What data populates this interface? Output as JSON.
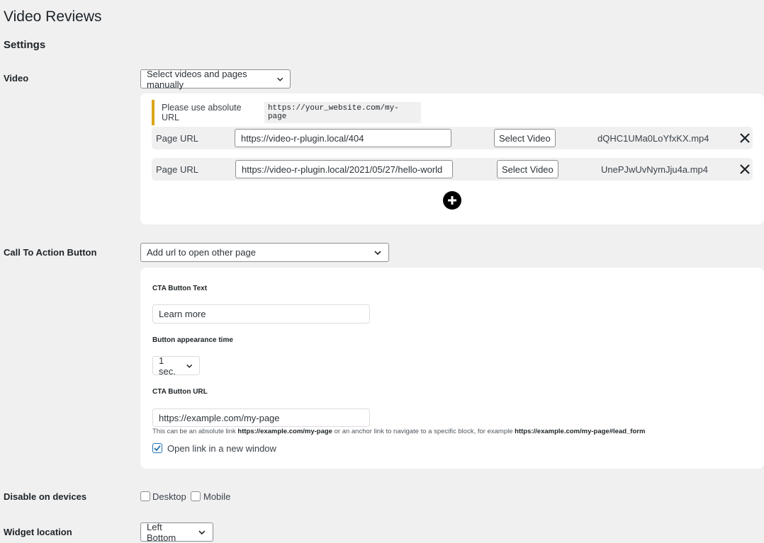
{
  "page_title": "Video Reviews",
  "section_title": "Settings",
  "video": {
    "label": "Video",
    "mode_select": "Select videos and pages manually",
    "notice_text": "Please use absolute URL",
    "notice_code": "https://your_website.com/my-page",
    "rows": [
      {
        "label": "Page URL",
        "url": "https://video-r-plugin.local/404",
        "button": "Select Video",
        "file": "dQHC1UMa0LoYfxKX.mp4"
      },
      {
        "label": "Page URL",
        "url": "https://video-r-plugin.local/2021/05/27/hello-world",
        "button": "Select Video",
        "file": "UnePJwUvNymJju4a.mp4"
      }
    ],
    "add_icon": "plus-circle-icon",
    "remove_icon": "close-icon"
  },
  "cta": {
    "label": "Call To Action Button",
    "mode_select": "Add url to open other page",
    "text_label": "CTA Button Text",
    "text_value": "Learn more",
    "time_label": "Button appearance time",
    "time_value": "1 sec.",
    "url_label": "CTA Button URL",
    "url_value": "https://example.com/my-page",
    "help_1": "This can be an absolute link ",
    "help_2": "https://example.com/my-page",
    "help_3": " or an anchor link to navigate to a specific block, for example ",
    "help_4": "https://example.com/my-page#lead_form",
    "new_window_label": "Open link in a new window",
    "new_window_checked": true
  },
  "devices": {
    "label": "Disable on devices",
    "desktop": "Desktop",
    "mobile": "Mobile"
  },
  "widget": {
    "label": "Widget location",
    "value": "Left Bottom"
  },
  "colors": {
    "accent": "#2271b1",
    "notice_border": "#dba617",
    "background": "#f0f0f1"
  }
}
